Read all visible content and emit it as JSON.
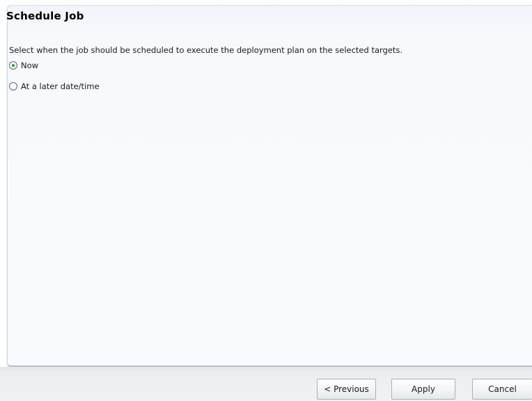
{
  "panel": {
    "title": "Schedule Job",
    "description": "Select when the job should be scheduled to execute the deployment plan on the selected targets.",
    "options": [
      {
        "label": "Now",
        "selected": true
      },
      {
        "label": "At a later date/time",
        "selected": false
      }
    ]
  },
  "footer": {
    "previous_label": "< Previous",
    "apply_label": "Apply",
    "cancel_label": "Cancel"
  },
  "colors": {
    "panel_background": "#f7f9fc",
    "selected_radio_dot": "#2f9b3a",
    "footer_background": "#eceef1"
  }
}
